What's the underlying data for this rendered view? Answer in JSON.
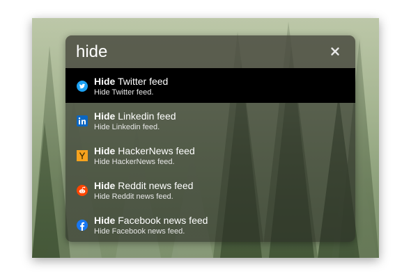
{
  "search": {
    "query": "hide",
    "close_icon": "close-icon"
  },
  "results": [
    {
      "bold": "Hide",
      "rest": " Twitter feed",
      "subtitle": "Hide Twitter feed.",
      "icon": "twitter-icon",
      "selected": true
    },
    {
      "bold": "Hide",
      "rest": " Linkedin feed",
      "subtitle": "Hide Linkedin feed.",
      "icon": "linkedin-icon",
      "selected": false
    },
    {
      "bold": "Hide",
      "rest": " HackerNews feed",
      "subtitle": "Hide HackerNews feed.",
      "icon": "hackernews-icon",
      "selected": false
    },
    {
      "bold": "Hide",
      "rest": " Reddit news feed",
      "subtitle": "Hide Reddit news feed.",
      "icon": "reddit-icon",
      "selected": false
    },
    {
      "bold": "Hide",
      "rest": " Facebook news feed",
      "subtitle": "Hide Facebook news feed.",
      "icon": "facebook-icon",
      "selected": false
    }
  ],
  "colors": {
    "selected_row": "#000000",
    "twitter": "#1DA1F2",
    "linkedin": "#0A66C2",
    "hackernews": "#F6A21E",
    "reddit": "#FF4500",
    "facebook": "#1877F2"
  }
}
